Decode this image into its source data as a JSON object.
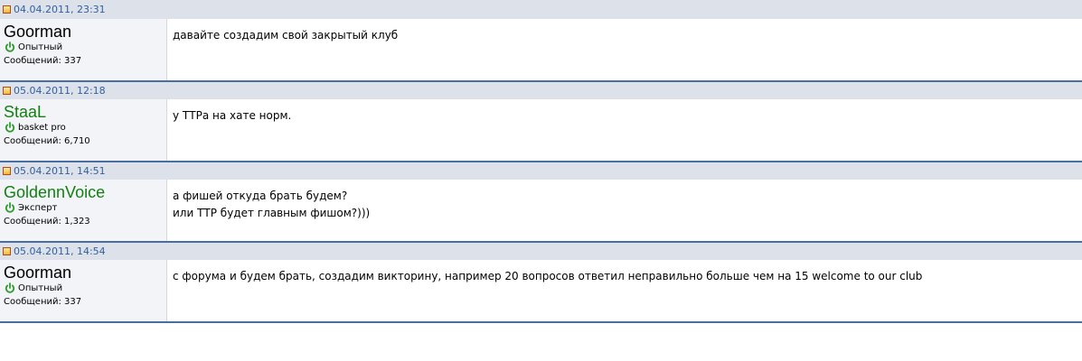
{
  "colors": {
    "header_bg": "#dde2ea",
    "separator": "#4a6ea2",
    "date_text": "#33609c",
    "userinfo_bg": "#f2f4f7",
    "username_green": "#128012",
    "online_icon": "#2e9c2e"
  },
  "posts": [
    {
      "date": "04.04.2011, 23:31",
      "username": "Goorman",
      "username_color": "black",
      "rank": "Опытный",
      "postcount": "Сообщений: 337",
      "status_icon": "online-power-icon",
      "message": [
        "давайте создадим свой закрытый клуб"
      ]
    },
    {
      "date": "05.04.2011, 12:18",
      "username": "StaaL",
      "username_color": "green",
      "rank": "basket pro",
      "postcount": "Сообщений: 6,710",
      "status_icon": "online-power-icon",
      "message": [
        "у ТТРа на хате норм."
      ]
    },
    {
      "date": "05.04.2011, 14:51",
      "username": "GoldennVoice",
      "username_color": "green",
      "rank": "Эксперт",
      "postcount": "Сообщений: 1,323",
      "status_icon": "online-power-icon",
      "message": [
        "а фишей откуда брать будем?",
        "или ТТР будет главным фишом?)))"
      ]
    },
    {
      "date": "05.04.2011, 14:54",
      "username": "Goorman",
      "username_color": "black",
      "rank": "Опытный",
      "postcount": "Сообщений: 337",
      "status_icon": "online-power-icon",
      "message": [
        "с форума и будем брать, создадим викторину, например 20 вопросов ответил неправильно больше чем на 15 welcome to our club"
      ]
    }
  ]
}
